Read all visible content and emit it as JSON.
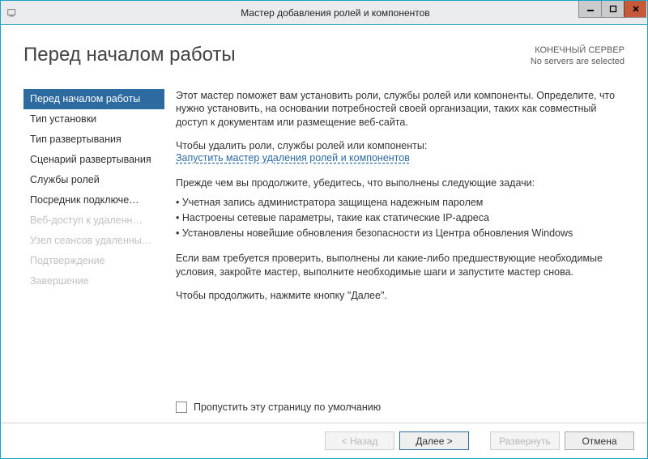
{
  "window": {
    "title": "Мастер добавления ролей и компонентов"
  },
  "header": {
    "page_title": "Перед началом работы",
    "server_label": "КОНЕЧНЫЙ СЕРВЕР",
    "server_status": "No servers are selected"
  },
  "nav": {
    "items": [
      {
        "label": "Перед началом работы",
        "state": "selected"
      },
      {
        "label": "Тип установки",
        "state": "enabled"
      },
      {
        "label": "Тип развертывания",
        "state": "enabled"
      },
      {
        "label": "Сценарий развертывания",
        "state": "enabled"
      },
      {
        "label": "Службы ролей",
        "state": "enabled"
      },
      {
        "label": "Посредник подключе…",
        "state": "enabled"
      },
      {
        "label": "Веб-доступ к удаленн…",
        "state": "disabled"
      },
      {
        "label": "Узел сеансов удаленны…",
        "state": "disabled"
      },
      {
        "label": "Подтверждение",
        "state": "disabled"
      },
      {
        "label": "Завершение",
        "state": "disabled"
      }
    ]
  },
  "main": {
    "intro": "Этот мастер поможет вам установить роли, службы ролей или компоненты. Определите, что нужно установить, на основании потребностей своей организации, таких как совместный доступ к документам или размещение веб-сайта.",
    "remove_lead": "Чтобы удалить роли, службы ролей или компоненты:",
    "remove_link": "Запустить мастер удаления ролей и компонентов",
    "prereq_lead": "Прежде чем вы продолжите, убедитесь, что выполнены следующие задачи:",
    "bullets": [
      "Учетная запись администратора защищена надежным паролем",
      "Настроены сетевые параметры, такие как статические IP-адреса",
      "Установлены новейшие обновления безопасности из Центра обновления Windows"
    ],
    "verify": "Если вам требуется проверить, выполнены ли какие-либо предшествующие необходимые условия, закройте мастер, выполните необходимые шаги и запустите мастер снова.",
    "continue": "Чтобы продолжить, нажмите кнопку \"Далее\"."
  },
  "skip": {
    "label": "Пропустить эту страницу по умолчанию"
  },
  "footer": {
    "back": "< Назад",
    "next": "Далее >",
    "install": "Развернуть",
    "cancel": "Отмена"
  }
}
